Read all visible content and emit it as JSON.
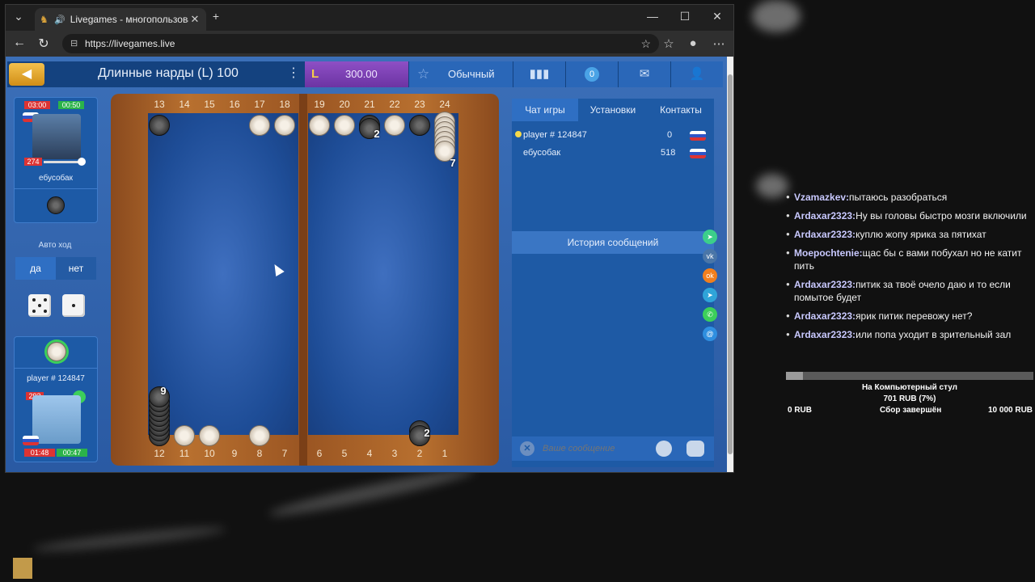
{
  "browser": {
    "tab_title": "Livegames - многопользова",
    "url": "https://livegames.live"
  },
  "game": {
    "title": "Длинные нарды (L) 100",
    "balance": "300.00",
    "mode": "Обычный",
    "notifications": "0"
  },
  "opponent": {
    "name": "ебусобак",
    "timer_total": "03:00",
    "timer_move": "00:50",
    "rating": "274"
  },
  "player": {
    "name": "player # 124847",
    "rating": "293",
    "timer_total": "01:48",
    "timer_move": "00:47"
  },
  "autoplay": {
    "label": "Авто ход",
    "yes": "да",
    "no": "нет"
  },
  "board": {
    "top_points": [
      "13",
      "14",
      "15",
      "16",
      "17",
      "18",
      "19",
      "20",
      "21",
      "22",
      "23",
      "24"
    ],
    "bottom_points": [
      "12",
      "11",
      "10",
      "9",
      "8",
      "7",
      "6",
      "5",
      "4",
      "3",
      "2",
      "1"
    ],
    "stack_top_21": "2",
    "stack_top_24": "7",
    "stack_bottom_12": "9",
    "stack_bottom_2": "2"
  },
  "chat": {
    "tabs": [
      "Чат игры",
      "Установки",
      "Контакты"
    ],
    "players": [
      {
        "name": "player # 124847",
        "score": "0"
      },
      {
        "name": "ебусобак",
        "score": "518"
      }
    ],
    "history_label": "История сообщений",
    "input_placeholder": "Ваше сообщение"
  },
  "stream": {
    "messages": [
      {
        "user": "Vzamazkev:",
        "text": "пытаюсь разобраться"
      },
      {
        "user": "Ardaxar2323:",
        "text": "Ну вы головы быстро мозги включили"
      },
      {
        "user": "Ardaxar2323:",
        "text": "куплю жопу ярика за пятихат"
      },
      {
        "user": "Moepochtenie:",
        "text": "щас бы с вами побухал но не катит пить"
      },
      {
        "user": "Ardaxar2323:",
        "text": "питик за твоё очело даю и то если помытое будет"
      },
      {
        "user": "Ardaxar2323:",
        "text": "ярик питик перевожу нет?"
      },
      {
        "user": "Ardaxar2323:",
        "text": "или попа уходит в зрительный зал"
      }
    ],
    "donation": {
      "title": "На Компьютерный стул",
      "progress": "701 RUB (7%)",
      "min": "0 RUB",
      "status": "Сбор завершён",
      "max": "10 000 RUB",
      "fraction": 0.07
    }
  }
}
